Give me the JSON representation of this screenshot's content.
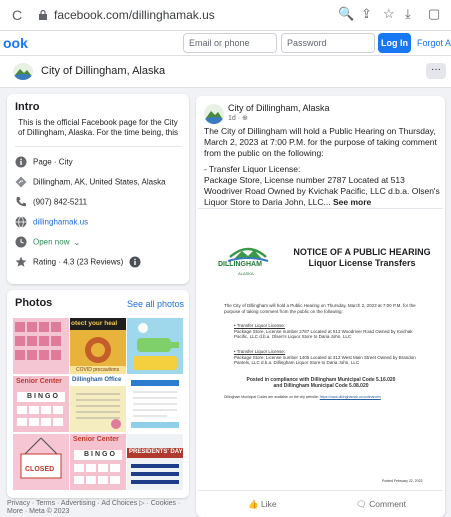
{
  "browser": {
    "url": "facebook.com/dillinghamak.us"
  },
  "topbar": {
    "logo": "ook",
    "email_placeholder": "Email or phone",
    "password_placeholder": "Password",
    "login_label": "Log In",
    "forgot_label": "Forgot Ac"
  },
  "page": {
    "name": "City of Dillingham, Alaska",
    "more_label": "···"
  },
  "intro": {
    "title": "Intro",
    "description": "This is the official Facebook page for the City of Dillingham, Alaska. For the time being, this sit",
    "category": "Page · City",
    "address": "Dillingham, AK, United States, Alaska",
    "phone": "(907) 842-5211",
    "website": "dillinghamak.us",
    "hours": "Open now",
    "rating": "Rating · 4.3 (23 Reviews)"
  },
  "photos": {
    "title": "Photos",
    "see_all": "See all photos"
  },
  "footer": {
    "text": "Privacy · Terms · Advertising · Ad Choices ▷ · Cookies · More · Meta © 2023"
  },
  "post": {
    "author": "City of Dillingham, Alaska",
    "meta": "1d ·",
    "paragraph1": "The City of Dillingham will hold a Public Hearing on Thursday, March 2, 2023 at 7:00 P.M. for the purpose of taking comment from the public on the following:",
    "paragraph2": "- Transfer Liquor License:",
    "paragraph3": "Package Store, License number 2787 Located at 513 Woodriver Road Owned by Kvichak Pacific, LLC d.b.a. Olsen's Liquor Store to Daria John, LLC...",
    "see_more": "See more",
    "like_label": "Like",
    "comment_label": "Comment"
  },
  "document": {
    "logo_text": "DILLINGHAM",
    "logo_subtext": "ALASKA",
    "title_line1": "NOTICE OF A PUBLIC HEARING",
    "title_line2": "Liquor License Transfers",
    "body": "The City of Dillingham will hold a Public Hearing on Thursday, March 2, 2023 at 7:00 P.M. for the purpose of taking comment from the public on the following:",
    "item1_title": "Transfer Liquor License:",
    "item1_text": "Package Store, License number 2787 Located at 513 Woodriver Road Owned by Kvichak Pacific, LLC d.b.a. Olsen's Liquor Store to Daria John, LLC",
    "item2_title": "Transfer Liquor License:",
    "item2_text": "Package Store, License number 1405 Located at 312 West Main Street Owned by Brandon Pantels, LLC d.b.a. Dillingham Liquor Store to Daria John, LLC",
    "posted_line1": "Posted in compliance with Dillingham Municipal Code 5.16.020",
    "posted_line2": "and Dillingham Municipal Code 5.08.020",
    "code_note": "Dillingham Municipal Codes are available on the city website:",
    "code_link": "https://www.dillinghamak.us/ordinances",
    "posted_date": "Posted February 22, 2023"
  },
  "thumbs": [
    {
      "caption": "",
      "color": "#e8a5b8"
    },
    {
      "caption": "otect your heal",
      "color": "#f2c94c"
    },
    {
      "caption": "",
      "color": "#8fd0e8"
    },
    {
      "caption": "Senior Center",
      "color": "#f2b8c6"
    },
    {
      "caption": "Dillingham Office",
      "color": "#f3e6a8"
    },
    {
      "caption": "",
      "color": "#d9eef5"
    },
    {
      "caption": "CLOSED",
      "color": "#f5b2c5"
    },
    {
      "caption": "Senior Center",
      "color": "#f2b8c6"
    },
    {
      "caption": "PRESIDENTS' DAY",
      "color": "#e8eef2"
    }
  ],
  "thumb_subcaptions": [
    "COVID precautions",
    "BINGO",
    "BINGO"
  ]
}
